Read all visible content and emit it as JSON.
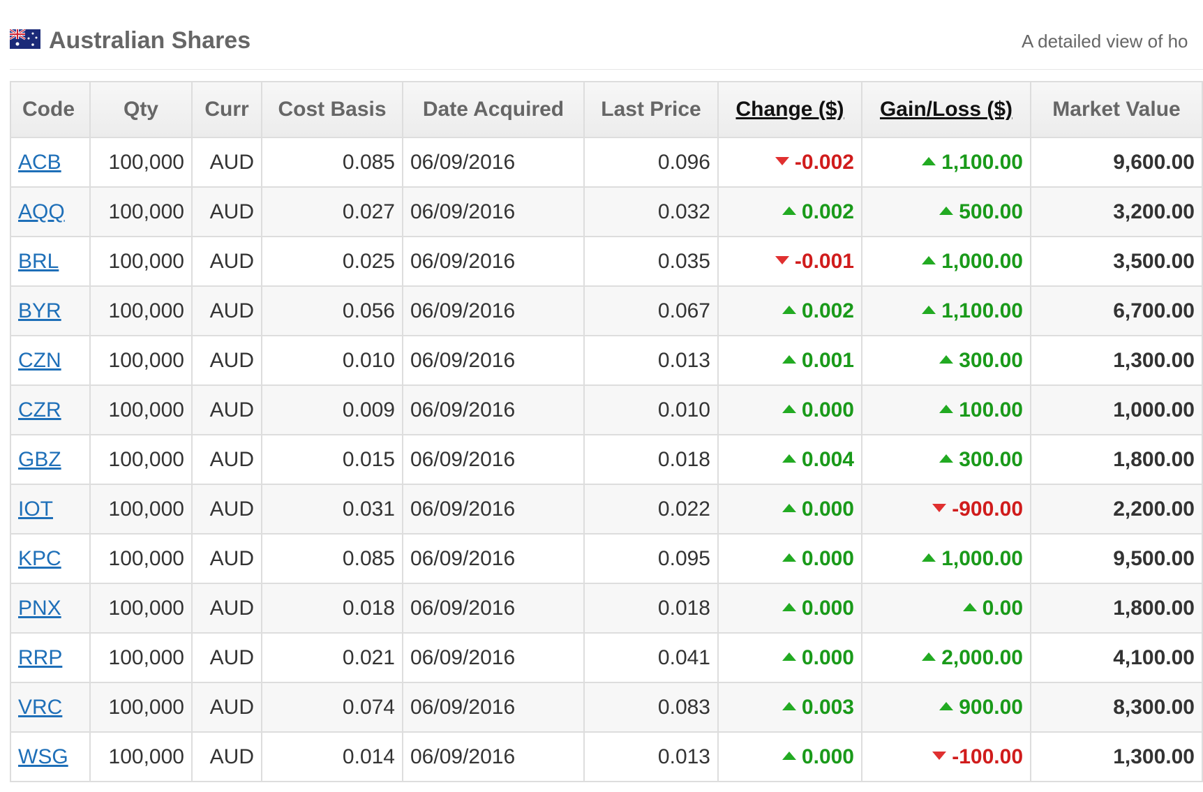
{
  "header": {
    "flag_icon": "australia-flag-icon",
    "title": "Australian Shares",
    "subtitle": "A detailed view of ho"
  },
  "table": {
    "columns": [
      "Code",
      "Qty",
      "Curr",
      "Cost Basis",
      "Date Acquired",
      "Last Price",
      "Change ($)",
      "Gain/Loss ($)",
      "Market Value"
    ],
    "rows": [
      {
        "code": "ACB",
        "qty": "100,000",
        "curr": "AUD",
        "cost": "0.085",
        "date": "06/09/2016",
        "last": "0.096",
        "change": "-0.002",
        "change_dir": "down",
        "gain": "1,100.00",
        "gain_dir": "up",
        "mv": "9,600.00"
      },
      {
        "code": "AQQ",
        "qty": "100,000",
        "curr": "AUD",
        "cost": "0.027",
        "date": "06/09/2016",
        "last": "0.032",
        "change": "0.002",
        "change_dir": "up",
        "gain": "500.00",
        "gain_dir": "up",
        "mv": "3,200.00"
      },
      {
        "code": "BRL",
        "qty": "100,000",
        "curr": "AUD",
        "cost": "0.025",
        "date": "06/09/2016",
        "last": "0.035",
        "change": "-0.001",
        "change_dir": "down",
        "gain": "1,000.00",
        "gain_dir": "up",
        "mv": "3,500.00"
      },
      {
        "code": "BYR",
        "qty": "100,000",
        "curr": "AUD",
        "cost": "0.056",
        "date": "06/09/2016",
        "last": "0.067",
        "change": "0.002",
        "change_dir": "up",
        "gain": "1,100.00",
        "gain_dir": "up",
        "mv": "6,700.00"
      },
      {
        "code": "CZN",
        "qty": "100,000",
        "curr": "AUD",
        "cost": "0.010",
        "date": "06/09/2016",
        "last": "0.013",
        "change": "0.001",
        "change_dir": "up",
        "gain": "300.00",
        "gain_dir": "up",
        "mv": "1,300.00"
      },
      {
        "code": "CZR",
        "qty": "100,000",
        "curr": "AUD",
        "cost": "0.009",
        "date": "06/09/2016",
        "last": "0.010",
        "change": "0.000",
        "change_dir": "up",
        "gain": "100.00",
        "gain_dir": "up",
        "mv": "1,000.00"
      },
      {
        "code": "GBZ",
        "qty": "100,000",
        "curr": "AUD",
        "cost": "0.015",
        "date": "06/09/2016",
        "last": "0.018",
        "change": "0.004",
        "change_dir": "up",
        "gain": "300.00",
        "gain_dir": "up",
        "mv": "1,800.00"
      },
      {
        "code": "IOT",
        "qty": "100,000",
        "curr": "AUD",
        "cost": "0.031",
        "date": "06/09/2016",
        "last": "0.022",
        "change": "0.000",
        "change_dir": "up",
        "gain": "-900.00",
        "gain_dir": "down",
        "mv": "2,200.00"
      },
      {
        "code": "KPC",
        "qty": "100,000",
        "curr": "AUD",
        "cost": "0.085",
        "date": "06/09/2016",
        "last": "0.095",
        "change": "0.000",
        "change_dir": "up",
        "gain": "1,000.00",
        "gain_dir": "up",
        "mv": "9,500.00"
      },
      {
        "code": "PNX",
        "qty": "100,000",
        "curr": "AUD",
        "cost": "0.018",
        "date": "06/09/2016",
        "last": "0.018",
        "change": "0.000",
        "change_dir": "up",
        "gain": "0.00",
        "gain_dir": "up",
        "mv": "1,800.00"
      },
      {
        "code": "RRP",
        "qty": "100,000",
        "curr": "AUD",
        "cost": "0.021",
        "date": "06/09/2016",
        "last": "0.041",
        "change": "0.000",
        "change_dir": "up",
        "gain": "2,000.00",
        "gain_dir": "up",
        "mv": "4,100.00"
      },
      {
        "code": "VRC",
        "qty": "100,000",
        "curr": "AUD",
        "cost": "0.074",
        "date": "06/09/2016",
        "last": "0.083",
        "change": "0.003",
        "change_dir": "up",
        "gain": "900.00",
        "gain_dir": "up",
        "mv": "8,300.00"
      },
      {
        "code": "WSG",
        "qty": "100,000",
        "curr": "AUD",
        "cost": "0.014",
        "date": "06/09/2016",
        "last": "0.013",
        "change": "0.000",
        "change_dir": "up",
        "gain": "-100.00",
        "gain_dir": "down",
        "mv": "1,300.00"
      }
    ]
  },
  "colors": {
    "link": "#1e6fb8",
    "up": "#1a9a1a",
    "down": "#d01c1c",
    "title": "#666666"
  }
}
